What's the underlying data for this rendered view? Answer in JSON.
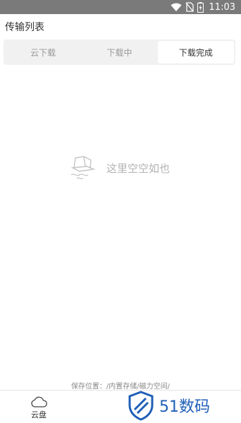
{
  "status_bar": {
    "time": "11:03",
    "icons": [
      "wifi-icon",
      "no-sim-icon",
      "battery-charging-icon"
    ]
  },
  "page": {
    "title": "传输列表"
  },
  "tabs": [
    {
      "label": "云下载",
      "active": false
    },
    {
      "label": "下载中",
      "active": false
    },
    {
      "label": "下载完成",
      "active": true
    }
  ],
  "empty_state": {
    "icon": "empty-box-icon",
    "text": "这里空空如也"
  },
  "footer": {
    "save_location": "保存位置：/内置存储/磁力空间/"
  },
  "bottom_nav": {
    "cloud_label": "云盘",
    "cloud_icon": "cloud-icon"
  },
  "watermark": {
    "text": "51数码"
  },
  "colors": {
    "status_bar": "#7a7a7a",
    "tab_bg": "#f1f1f1",
    "watermark": "#1f5fb8"
  }
}
